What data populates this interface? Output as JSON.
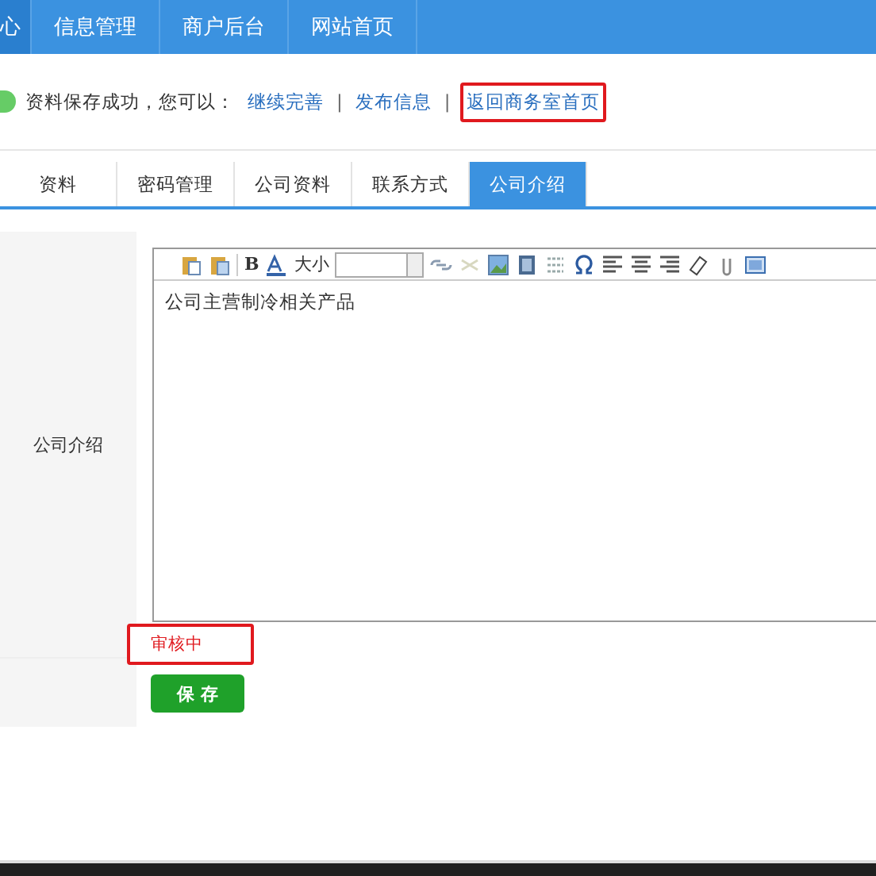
{
  "nav": [
    {
      "label": "心",
      "selected": true
    },
    {
      "label": "信息管理",
      "selected": false
    },
    {
      "label": "商户后台",
      "selected": false
    },
    {
      "label": "网站首页",
      "selected": false
    }
  ],
  "message": {
    "text": "资料保存成功，您可以：",
    "links": [
      {
        "label": "继续完善",
        "highlighted": false
      },
      {
        "label": "发布信息",
        "highlighted": false
      },
      {
        "label": "返回商务室首页",
        "highlighted": true
      }
    ],
    "separator": "|"
  },
  "tabs": [
    {
      "label": "资料",
      "selected": false
    },
    {
      "label": "密码管理",
      "selected": false
    },
    {
      "label": "公司资料",
      "selected": false
    },
    {
      "label": "联系方式",
      "selected": false
    },
    {
      "label": "公司介绍",
      "selected": true
    }
  ],
  "form": {
    "label": "公司介绍",
    "toolbar": {
      "bold": "B",
      "size_label": "大小"
    },
    "content": "公司主营制冷相关产品",
    "status": "审核中",
    "save": "保 存"
  }
}
